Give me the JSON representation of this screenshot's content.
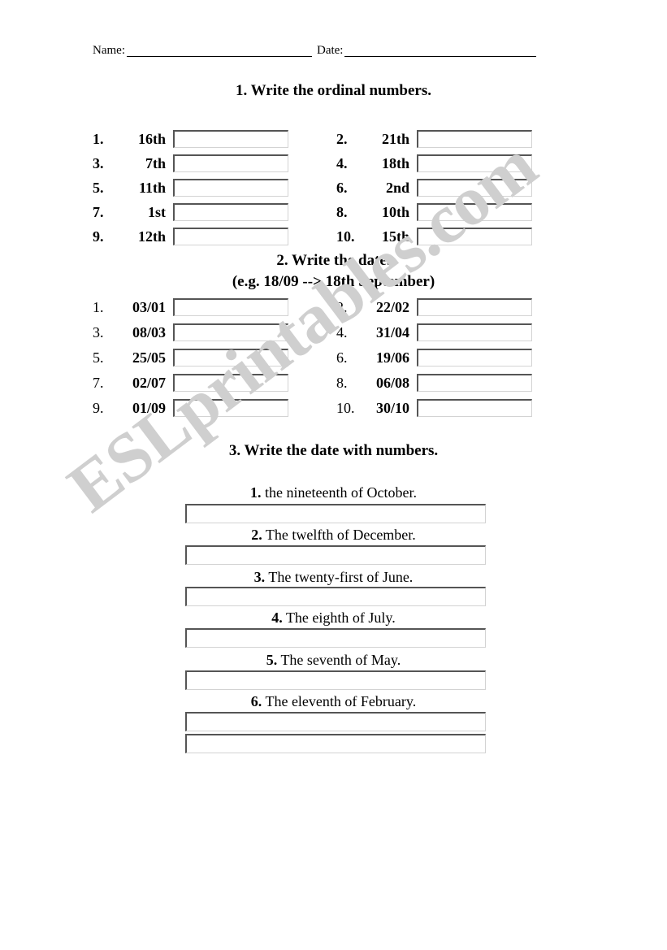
{
  "header": {
    "name_label": "Name:",
    "date_label": "Date:"
  },
  "watermark": {
    "text": "ESLprintables.com",
    "color": "#cfcfcf"
  },
  "section1": {
    "heading": "1. Write the ordinal numbers.",
    "items": [
      {
        "num": "1.",
        "value": "16th"
      },
      {
        "num": "2.",
        "value": "21th"
      },
      {
        "num": "3.",
        "value": "7th"
      },
      {
        "num": "4.",
        "value": "18th"
      },
      {
        "num": "5.",
        "value": "11th"
      },
      {
        "num": "6.",
        "value": "2nd"
      },
      {
        "num": "7.",
        "value": "1st"
      },
      {
        "num": "8.",
        "value": "10th"
      },
      {
        "num": "9.",
        "value": "12th"
      },
      {
        "num": "10.",
        "value": "15th"
      }
    ]
  },
  "section2": {
    "heading": "2. Write the date.",
    "subheading": "(e.g. 18/09 --> 18th September)",
    "items": [
      {
        "num": "1.",
        "value": "03/01"
      },
      {
        "num": "2.",
        "value": "22/02"
      },
      {
        "num": "3.",
        "value": "08/03"
      },
      {
        "num": "4.",
        "value": "31/04"
      },
      {
        "num": "5.",
        "value": "25/05"
      },
      {
        "num": "6.",
        "value": "19/06"
      },
      {
        "num": "7.",
        "value": "02/07"
      },
      {
        "num": "8.",
        "value": "06/08"
      },
      {
        "num": "9.",
        "value": "01/09"
      },
      {
        "num": "10.",
        "value": "30/10"
      }
    ]
  },
  "section3": {
    "heading": "3. Write the date with numbers.",
    "items": [
      {
        "num": "1.",
        "prompt": "the nineteenth of October."
      },
      {
        "num": "2.",
        "prompt": "The twelfth of December."
      },
      {
        "num": "3.",
        "prompt": "The twenty-first of June."
      },
      {
        "num": "4.",
        "prompt": "The eighth of July."
      },
      {
        "num": "5.",
        "prompt": "The seventh of May."
      },
      {
        "num": "6.",
        "prompt": "The eleventh of February."
      }
    ]
  }
}
